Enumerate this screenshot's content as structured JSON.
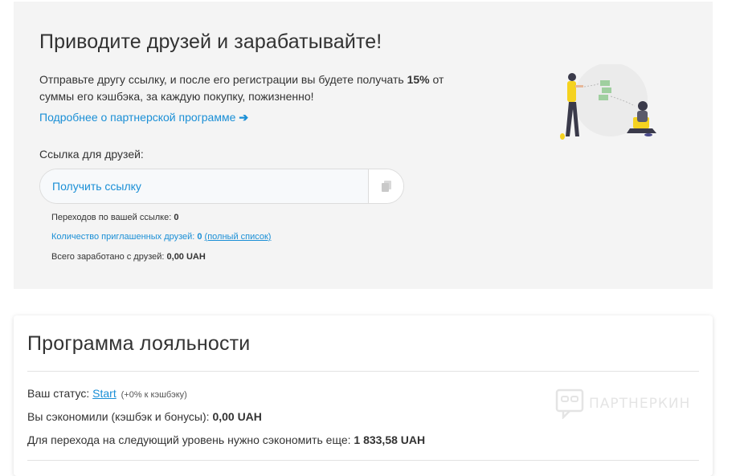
{
  "referral": {
    "title": "Приводите друзей и зарабатывайте!",
    "desc_prefix": "Отправьте другу ссылку, и после его регистрации вы будете получать ",
    "desc_percent": "15%",
    "desc_suffix": " от суммы его кэшбэка, за каждую покупку, пожизненно!",
    "more_link": "Подробнее о партнерской программе",
    "link_label": "Ссылка для друзей:",
    "get_link_button": "Получить ссылку",
    "copy_icon": "copy-icon",
    "stats": {
      "visits_label": "Переходов по вашей ссылке: ",
      "visits_value": "0",
      "invited_label": "Количество приглашенных друзей: ",
      "invited_value": "0",
      "full_list_link": "(полный список)",
      "earned_label": "Всего заработано с друзей: ",
      "earned_value": "0,00 UAH"
    }
  },
  "loyalty": {
    "title": "Программа лояльности",
    "status_label": "Ваш статус: ",
    "status_value": "Start",
    "status_note": "(+0% к кэшбэку)",
    "saved_label": "Вы сэкономили (кэшбэк и бонусы): ",
    "saved_value": "0,00 UAH",
    "next_level_label": "Для перехода на следующий уровень нужно сэкономить еще: ",
    "next_level_value": "1 833,58 UAH"
  },
  "watermark": {
    "text": "ПАРТНЕРКИН"
  },
  "colors": {
    "accent": "#1a8fd6",
    "panel_bg": "#f4f4f4",
    "illustration_yellow": "#f5d21f"
  }
}
